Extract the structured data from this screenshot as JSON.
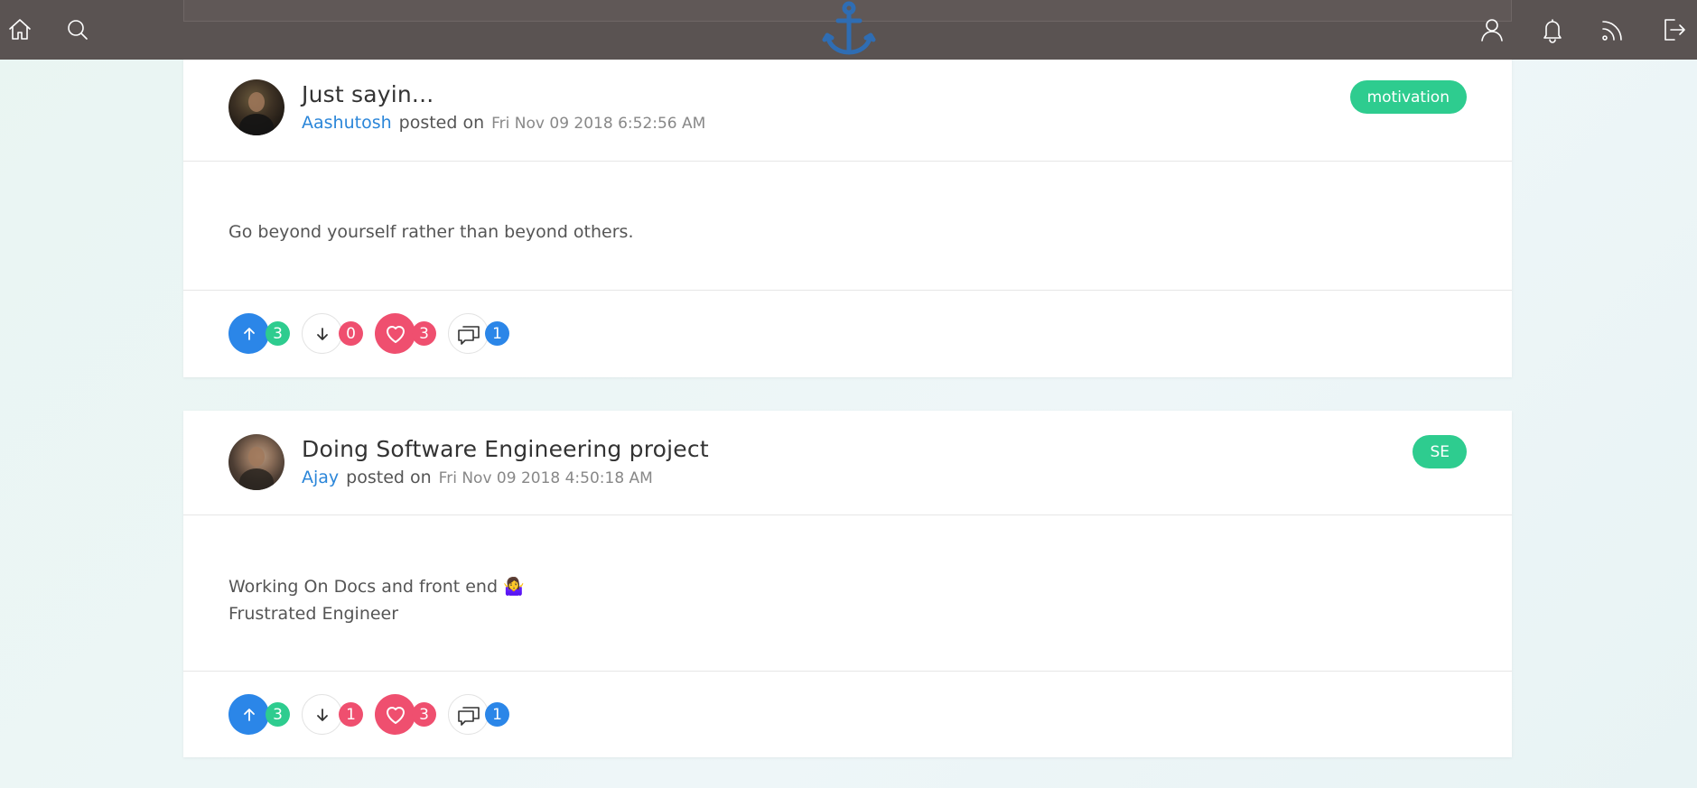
{
  "nav": {
    "left_icons": [
      "home-icon",
      "search-icon"
    ],
    "center_logo": "anchor-icon",
    "right_icons": [
      "user-icon",
      "bell-icon",
      "rss-icon",
      "logout-icon"
    ]
  },
  "colors": {
    "navbar": "#5a5352",
    "accent_blue": "#2b86e8",
    "tag_green": "#2ecc8f",
    "heart_red": "#ef4f6f",
    "author_link": "#2b86d9"
  },
  "posts": [
    {
      "title": "Just sayin...",
      "author": "Aashutosh",
      "posted_on_label": "posted on",
      "date": "Fri Nov 09 2018 6:52:56 AM",
      "tag": "motivation",
      "body_lines": [
        "Go beyond yourself rather than beyond others."
      ],
      "upvotes": "3",
      "downvotes": "0",
      "likes": "3",
      "comments": "1"
    },
    {
      "title": "Doing Software Engineering project",
      "author": "Ajay",
      "posted_on_label": "posted on",
      "date": "Fri Nov 09 2018 4:50:18 AM",
      "tag": "SE",
      "body_lines": [
        "Working On Docs and front end 🤷‍♀️",
        "Frustrated Engineer"
      ],
      "upvotes": "3",
      "downvotes": "1",
      "likes": "3",
      "comments": "1"
    }
  ]
}
